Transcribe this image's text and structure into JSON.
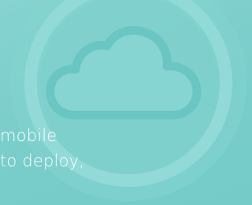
{
  "hero": {
    "icon": "cloud-icon",
    "colors": {
      "background": "#7ccfcc",
      "ring": "#8ed8d5",
      "cloud_fill": "#86d4d1",
      "cloud_outline": "#6ac5c2",
      "text": "#ffffff"
    },
    "caption_lines": [
      "mobile",
      "to deploy,"
    ]
  }
}
